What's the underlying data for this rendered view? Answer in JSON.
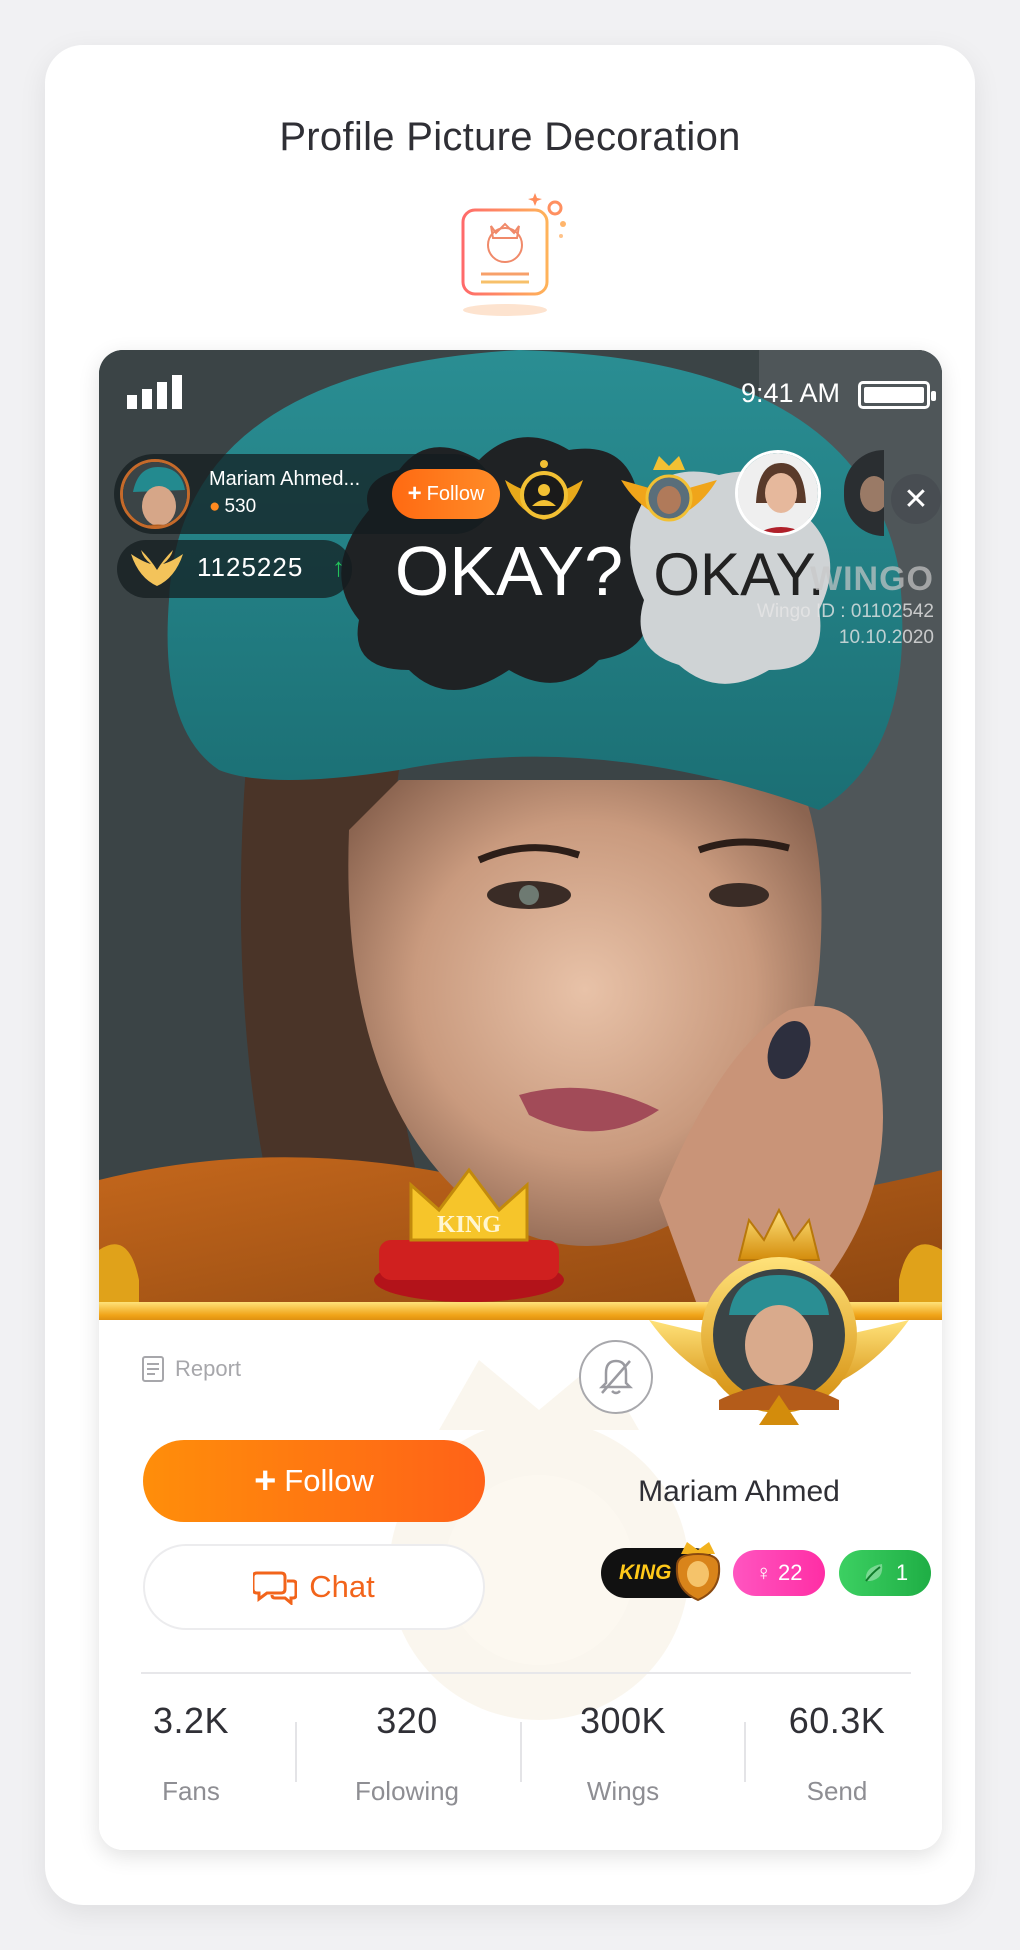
{
  "page": {
    "heading": "Profile Picture Decoration"
  },
  "status_bar": {
    "time": "9:41 AM"
  },
  "host": {
    "name": "Mariam Ahmed...",
    "fans": "530",
    "follow_label": "Follow"
  },
  "wings": {
    "count": "1125225"
  },
  "watermark": {
    "logo": "WINGO",
    "id": "Wingo ID : 01102542",
    "date": "10.10.2020"
  },
  "photo": {
    "hat_text_left": "OKAY?",
    "hat_text_right": "OKAY.",
    "crown_label": "KING"
  },
  "profile": {
    "report_label": "Report",
    "follow_label": "Follow",
    "chat_label": "Chat",
    "name": "Mariam Ahmed",
    "badges": {
      "king": "KING",
      "gender_count": "22",
      "leaf_count": "1"
    }
  },
  "stats": [
    {
      "value": "3.2K",
      "label": "Fans"
    },
    {
      "value": "320",
      "label": "Folowing"
    },
    {
      "value": "300K",
      "label": "Wings"
    },
    {
      "value": "60.3K",
      "label": "Send"
    }
  ],
  "colors": {
    "accent": "#ff7a12",
    "king_gold": "#ffc819",
    "gender_pink": "#ff3fae",
    "leaf_green": "#2bbf52"
  }
}
